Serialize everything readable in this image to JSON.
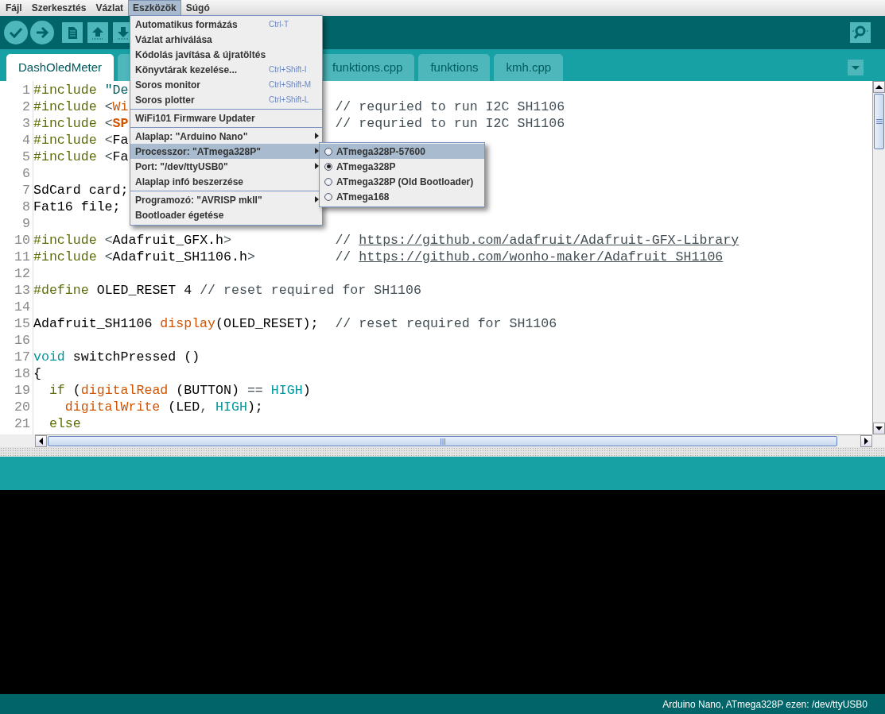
{
  "menu_bar": [
    {
      "label": "Fájl",
      "selected": false
    },
    {
      "label": "Szerkesztés",
      "selected": false
    },
    {
      "label": "Vázlat",
      "selected": false
    },
    {
      "label": "Eszközök",
      "selected": true
    },
    {
      "label": "Súgó",
      "selected": false
    }
  ],
  "toolbar": [
    {
      "kind": "verify"
    },
    {
      "kind": "upload"
    },
    {
      "kind": "new"
    },
    {
      "kind": "open"
    },
    {
      "kind": "save"
    }
  ],
  "tabs": [
    {
      "label": "DashOledMeter",
      "selected": true
    },
    {
      "selected": false
    },
    {
      "label": "funktions.cpp",
      "selected": false
    },
    {
      "label": "funktions",
      "selected": false
    },
    {
      "label": "kmh.cpp",
      "selected": false
    }
  ],
  "code_lines": [
    {
      "number": "1",
      "tokens": [
        {
          "kind": "directive",
          "text": "#include"
        },
        {
          "kind": "string",
          "text": " \"De"
        }
      ]
    },
    {
      "number": "2",
      "tokens": [
        {
          "kind": "directive",
          "text": "#include"
        },
        {
          "kind": "punct",
          "text": " <"
        },
        {
          "kind": "function",
          "text": "Wi"
        }
      ],
      "comment": [
        {
          "kind": "comment",
          "text": "// requried to run I2C SH1106"
        }
      ]
    },
    {
      "number": "3",
      "tokens": [
        {
          "kind": "directive",
          "text": "#include"
        },
        {
          "kind": "punct",
          "text": " <"
        },
        {
          "kind": "keyword",
          "text": "SP"
        }
      ],
      "comment": [
        {
          "kind": "comment",
          "text": "// requried to run I2C SH1106"
        }
      ]
    },
    {
      "number": "4",
      "tokens": [
        {
          "kind": "directive",
          "text": "#include"
        },
        {
          "kind": "punct",
          "text": " <"
        },
        {
          "kind": "plain",
          "text": "Fa"
        }
      ]
    },
    {
      "number": "5",
      "tokens": [
        {
          "kind": "directive",
          "text": "#include"
        },
        {
          "kind": "punct",
          "text": " <"
        },
        {
          "kind": "plain",
          "text": "Fa"
        }
      ]
    },
    {
      "number": "6"
    },
    {
      "number": "7",
      "tokens": [
        {
          "kind": "plain",
          "text": "SdCard card;"
        }
      ]
    },
    {
      "number": "8",
      "tokens": [
        {
          "kind": "plain",
          "text": "Fat16 file;"
        }
      ]
    },
    {
      "number": "9"
    },
    {
      "number": "10",
      "tokens": [
        {
          "kind": "directive",
          "text": "#include"
        },
        {
          "kind": "punct",
          "text": " <"
        },
        {
          "kind": "plain",
          "text": "Adafruit_GFX.h"
        },
        {
          "kind": "punct",
          "text": ">"
        }
      ],
      "comment": [
        {
          "kind": "comment",
          "text": "// "
        },
        {
          "kind": "url",
          "text": "https://github.com/adafruit/Adafruit-GFX-Library"
        }
      ]
    },
    {
      "number": "11",
      "tokens": [
        {
          "kind": "directive",
          "text": "#include"
        },
        {
          "kind": "punct",
          "text": " <"
        },
        {
          "kind": "plain",
          "text": "Adafruit_SH1106.h"
        },
        {
          "kind": "punct",
          "text": ">"
        }
      ],
      "comment": [
        {
          "kind": "comment",
          "text": "// "
        },
        {
          "kind": "url",
          "text": "https://github.com/wonho-maker/Adafruit_SH1106"
        }
      ]
    },
    {
      "number": "12"
    },
    {
      "number": "13",
      "tokens": [
        {
          "kind": "directive",
          "text": "#define"
        },
        {
          "kind": "plain",
          "text": " OLED_RESET 4 "
        },
        {
          "kind": "comment",
          "text": "// reset required for SH1106"
        }
      ]
    },
    {
      "number": "14"
    },
    {
      "number": "15",
      "tokens": [
        {
          "kind": "plain",
          "text": "Adafruit_SH1106 "
        },
        {
          "kind": "function",
          "text": "display"
        },
        {
          "kind": "plain",
          "text": "(OLED_RESET);"
        }
      ],
      "comment": [
        {
          "kind": "comment",
          "text": "// reset required for SH1106"
        }
      ]
    },
    {
      "number": "16"
    },
    {
      "number": "17",
      "tokens": [
        {
          "kind": "type",
          "text": "void"
        },
        {
          "kind": "plain",
          "text": " switchPressed ()"
        }
      ]
    },
    {
      "number": "18",
      "tokens": [
        {
          "kind": "plain",
          "text": "{"
        }
      ]
    },
    {
      "number": "19",
      "tokens": [
        {
          "kind": "directive",
          "text": "  if"
        },
        {
          "kind": "plain",
          "text": " ("
        },
        {
          "kind": "function",
          "text": "digitalRead"
        },
        {
          "kind": "plain",
          "text": " (BUTTON) "
        },
        {
          "kind": "punct",
          "text": "=="
        },
        {
          "kind": "type",
          "text": " HIGH"
        },
        {
          "kind": "plain",
          "text": ")"
        }
      ]
    },
    {
      "number": "20",
      "tokens": [
        {
          "kind": "function",
          "text": "    digitalWrite"
        },
        {
          "kind": "plain",
          "text": " (LED"
        },
        {
          "kind": "punct",
          "text": ","
        },
        {
          "kind": "type",
          "text": " HIGH"
        },
        {
          "kind": "plain",
          "text": ");"
        }
      ]
    },
    {
      "number": "21",
      "tokens": [
        {
          "kind": "directive",
          "text": "  else"
        }
      ]
    }
  ],
  "menu": {
    "items": [
      {
        "kind": "item",
        "label": "Automatikus formázás",
        "shortcut": "Ctrl-T",
        "highlighted": false
      },
      {
        "kind": "item",
        "label": "Vázlat arhiválása",
        "highlighted": false
      },
      {
        "kind": "item",
        "label": "Kódolás javítása & újratöltés",
        "highlighted": false
      },
      {
        "kind": "item",
        "label": "Könyvtárak kezelése...",
        "shortcut": "Ctrl+Shift-I",
        "highlighted": false
      },
      {
        "kind": "item",
        "label": "Soros monitor",
        "shortcut": "Ctrl+Shift-M",
        "highlighted": false
      },
      {
        "kind": "item",
        "label": "Soros plotter",
        "shortcut": "Ctrl+Shift-L",
        "highlighted": false
      },
      {
        "kind": "separator"
      },
      {
        "kind": "item",
        "label": "WiFi101 Firmware Updater",
        "highlighted": false
      },
      {
        "kind": "separator"
      },
      {
        "kind": "submenu",
        "label": "Alaplap: \"Arduino Nano\"",
        "highlighted": false
      },
      {
        "kind": "submenu",
        "label": "Processzor: \"ATmega328P\"",
        "highlighted": true
      },
      {
        "kind": "submenu",
        "label": "Port: \"/dev/ttyUSB0\"",
        "highlighted": false
      },
      {
        "kind": "item",
        "label": "Alaplap infó beszerzése",
        "highlighted": false
      },
      {
        "kind": "separator"
      },
      {
        "kind": "submenu",
        "label": "Programozó: \"AVRISP mkII\"",
        "highlighted": false
      },
      {
        "kind": "item",
        "label": "Bootloader égetése",
        "highlighted": false
      }
    ]
  },
  "submenu": {
    "items": [
      {
        "label": "ATmega328P-57600",
        "checked": false,
        "highlighted": true
      },
      {
        "label": "ATmega328P",
        "checked": true,
        "highlighted": false
      },
      {
        "label": "ATmega328P (Old Bootloader)",
        "checked": false,
        "highlighted": false
      },
      {
        "label": "ATmega168",
        "checked": false,
        "highlighted": false
      }
    ]
  },
  "status_bar": {
    "text": "Arduino Nano, ATmega328P ezen: /dev/ttyUSB0"
  }
}
